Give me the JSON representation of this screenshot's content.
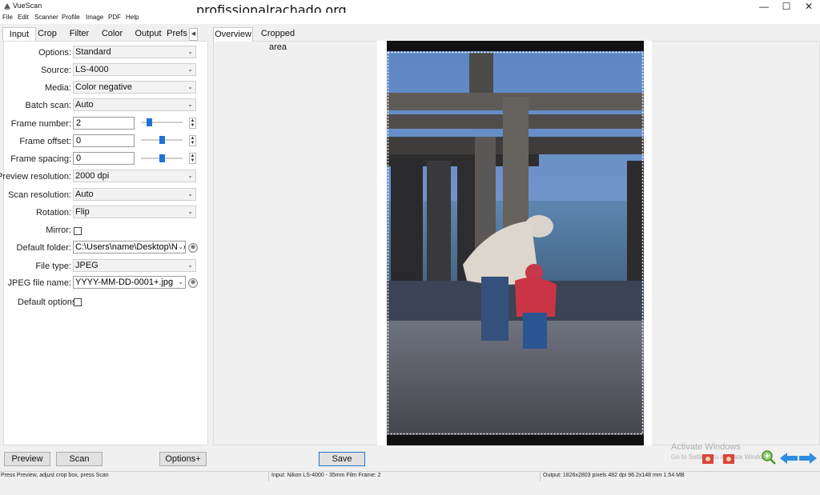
{
  "app": {
    "title": "VueScan",
    "watermark": "profissionalrachado.org"
  },
  "menu": [
    "File",
    "Edit",
    "Scanner",
    "Profile",
    "Image",
    "PDF",
    "Help"
  ],
  "left_tabs": [
    "Input",
    "Crop",
    "Filter",
    "Color",
    "Output",
    "Prefs"
  ],
  "right_tabs": [
    "Overview",
    "Cropped area"
  ],
  "settings": {
    "options": {
      "label": "Options:",
      "value": "Standard"
    },
    "source": {
      "label": "Source:",
      "value": "LS-4000"
    },
    "media": {
      "label": "Media:",
      "value": "Color negative"
    },
    "batch_scan": {
      "label": "Batch scan:",
      "value": "Auto"
    },
    "frame_number": {
      "label": "Frame number:",
      "value": "2",
      "level": 0.2
    },
    "frame_offset": {
      "label": "Frame offset:",
      "value": "0",
      "level": 0.5
    },
    "frame_spacing": {
      "label": "Frame spacing:",
      "value": "0",
      "level": 0.5
    },
    "preview_resolution": {
      "label": "Preview resolution:",
      "value": "2000 dpi"
    },
    "scan_resolution": {
      "label": "Scan resolution:",
      "value": "Auto"
    },
    "rotation": {
      "label": "Rotation:",
      "value": "Flip"
    },
    "mirror": {
      "label": "Mirror:",
      "checked": false
    },
    "default_folder": {
      "label": "Default folder:",
      "value": "C:\\Users\\name\\Desktop\\Nikc"
    },
    "file_type": {
      "label": "File type:",
      "value": "JPEG"
    },
    "jpeg_file_name": {
      "label": "JPEG file name:",
      "value": "YYYY-MM-DD-0001+.jpg"
    },
    "default_options": {
      "label": "Default options:",
      "checked": false
    }
  },
  "buttons": {
    "preview": "Preview",
    "scan": "Scan",
    "options": "Options+",
    "save": "Save"
  },
  "status": {
    "left": "Press Preview, adjust crop box, press Scan",
    "middle": "Input: Nikon LS-4000 - 35mm Film Frame: 2",
    "right": "Output: 1826x2803 pixels 482 dpi 96.2x148 mm 1.54 MB"
  },
  "watermark_windows": {
    "title": "Activate Windows",
    "subtitle": "Go to Settings to activate Windows."
  },
  "icons": [
    "app-scanner-icon",
    "minimize-icon",
    "maximize-icon",
    "close-icon",
    "zoom-in-icon",
    "arrow-left-icon",
    "arrow-right-icon",
    "photo-icon"
  ],
  "colors": {
    "slider_thumb": "#1f74d1",
    "nav_arrow": "#2e8de0"
  }
}
